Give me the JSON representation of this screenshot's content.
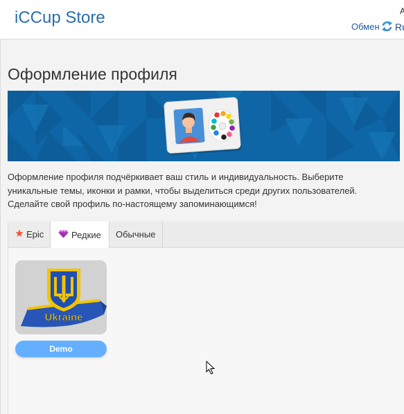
{
  "header": {
    "brand": "iCCup Store",
    "corner_text": "A",
    "exchange_label": "Обмен",
    "exchange_icon": "refresh-icon",
    "language": "Ru"
  },
  "page": {
    "title": "Оформление профиля",
    "description": "Оформление профиля подчёркивает ваш стиль и индивидуальность. Выберите уникальные темы, иконки и рамки, чтобы выделиться среди других пользователей. Сделайте свой профиль по-настоящему запоминающимся!"
  },
  "tabs": [
    {
      "label": "Epic",
      "icon": "star-icon",
      "active": false
    },
    {
      "label": "Редкие",
      "icon": "diamond-icon",
      "active": true
    },
    {
      "label": "Обычные",
      "icon": "",
      "active": false
    }
  ],
  "items": [
    {
      "name": "Ukraine",
      "button_label": "Demo"
    }
  ],
  "colors": {
    "brand": "#2a6fa8",
    "banner": "#0e66a6",
    "demo_button": "#64afff",
    "star": "#f15a3a",
    "diamond": "#c23fd0"
  }
}
